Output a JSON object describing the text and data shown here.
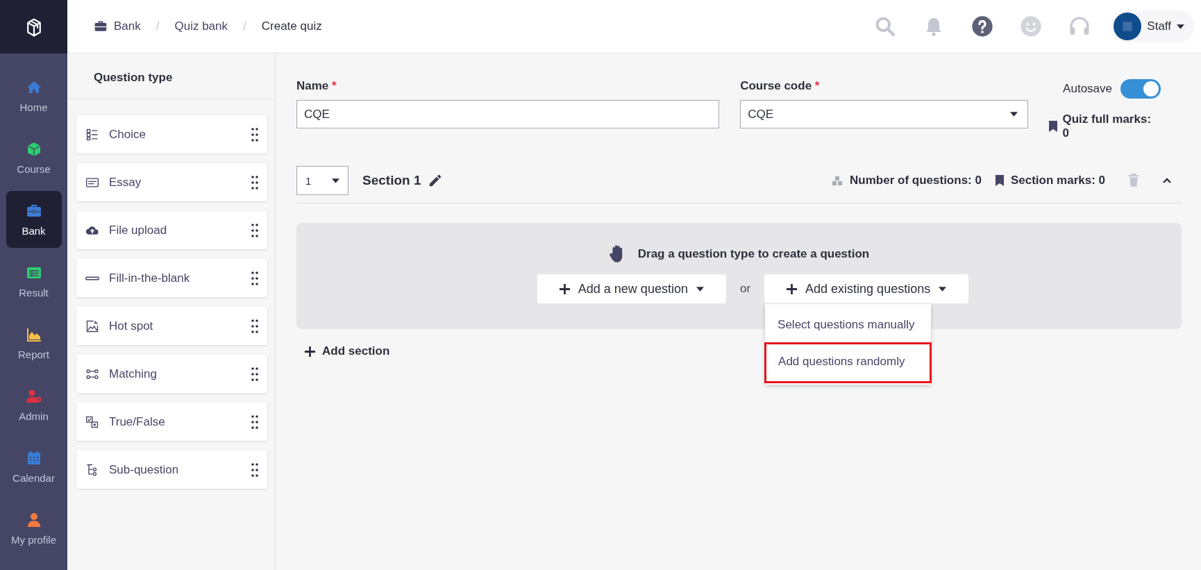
{
  "sidebar": {
    "items": [
      {
        "label": "Home",
        "kind": "home",
        "color": "#3a7bd5",
        "selected": false
      },
      {
        "label": "Course",
        "kind": "cube",
        "color": "#2ecc71",
        "selected": false
      },
      {
        "label": "Bank",
        "kind": "briefcase",
        "color": "#3a7bd5",
        "selected": true
      },
      {
        "label": "Result",
        "kind": "sheet",
        "color": "#2ecc71",
        "selected": false
      },
      {
        "label": "Report",
        "kind": "chart",
        "color": "#f5c04a",
        "selected": false
      },
      {
        "label": "Admin",
        "kind": "usergear",
        "color": "#e0313f",
        "selected": false
      },
      {
        "label": "Calendar",
        "kind": "calendar",
        "color": "#3a7bd5",
        "selected": false
      },
      {
        "label": "My profile",
        "kind": "user",
        "color": "#f47b3f",
        "selected": false
      }
    ]
  },
  "breadcrumb": [
    {
      "kind": "link",
      "label": "Bank"
    },
    {
      "kind": "separator",
      "label": "/"
    },
    {
      "kind": "link",
      "label": "Quiz bank"
    },
    {
      "kind": "separator",
      "label": "/"
    },
    {
      "kind": "current",
      "label": "Create quiz"
    }
  ],
  "user": {
    "name": "Staff"
  },
  "question_types": {
    "title": "Question type",
    "items": [
      {
        "label": "Choice",
        "kind": "choice"
      },
      {
        "label": "Essay",
        "kind": "essay"
      },
      {
        "label": "File upload",
        "kind": "upload"
      },
      {
        "label": "Fill-in-the-blank",
        "kind": "blank"
      },
      {
        "label": "Hot spot",
        "kind": "hotspot"
      },
      {
        "label": "Matching",
        "kind": "matching"
      },
      {
        "label": "True/False",
        "kind": "truefalse"
      },
      {
        "label": "Sub-question",
        "kind": "sub"
      }
    ]
  },
  "form": {
    "name": {
      "label": "Name",
      "required_mark": "*",
      "value": "CQE"
    },
    "course_code": {
      "label": "Course code",
      "required_mark": "*",
      "value": "CQE"
    },
    "autosave": {
      "label": "Autosave",
      "on": true
    },
    "quiz_full_marks": "Quiz full marks: 0"
  },
  "section": {
    "number": "1",
    "title": "Section 1",
    "number_of_questions": "Number of questions: 0",
    "section_marks": "Section marks: 0",
    "expanded": true
  },
  "dropzone": {
    "hint": "Drag a question type to create a question",
    "add_new": "Add a new question",
    "or": "or",
    "add_existing": "Add existing questions",
    "menu": {
      "open": true,
      "items": [
        {
          "label": "Select questions manually",
          "highlighted": false
        },
        {
          "label": "Add questions randomly",
          "highlighted": true
        }
      ]
    }
  },
  "add_section": "Add section"
}
